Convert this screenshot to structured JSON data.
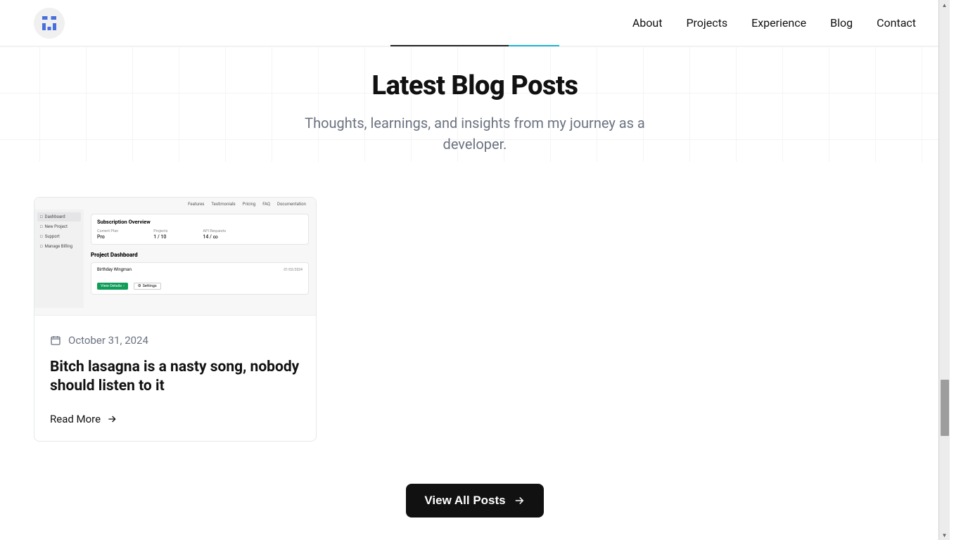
{
  "nav": {
    "about": "About",
    "projects": "Projects",
    "experience": "Experience",
    "blog": "Blog",
    "contact": "Contact"
  },
  "hero": {
    "title": "Latest Blog Posts",
    "subtitle": "Thoughts, learnings, and insights from my journey as a developer."
  },
  "post": {
    "date": "October 31, 2024",
    "title": "Bitch lasagna is a nasty song, nobody should listen to it",
    "read_more": "Read More"
  },
  "view_all": "View All Posts",
  "thumb": {
    "tabs": {
      "features": "Features",
      "testimonials": "Testimonials",
      "pricing": "Pricing",
      "faq": "FAQ",
      "docs": "Documentation"
    },
    "side": {
      "dashboard": "Dashboard",
      "new_project": "New Project",
      "support": "Support",
      "manage_billing": "Manage Billing"
    },
    "sub_title": "Subscription Overview",
    "plan_lbl": "Current Plan",
    "plan_val": "Pro",
    "projects_lbl": "Projects",
    "projects_val": "1 / 10",
    "api_lbl": "API Requests",
    "api_val": "14 / ∞",
    "dash_title": "Project Dashboard",
    "proj_name": "Birthday Wingman",
    "proj_date": "01/02/2024",
    "view_details": "View Details",
    "settings": "Settings"
  }
}
